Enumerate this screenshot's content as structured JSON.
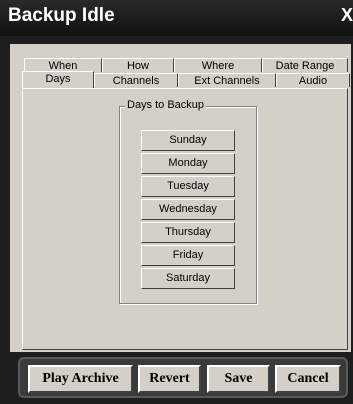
{
  "window": {
    "title": "Backup Idle",
    "close_glyph": "X"
  },
  "tabs_back": [
    "When",
    "How",
    "Where",
    "Date Range"
  ],
  "tabs_front": [
    "Days",
    "Channels",
    "Ext Channels",
    "Audio"
  ],
  "active_tab": "Days",
  "group": {
    "label": "Days to Backup",
    "days": [
      "Sunday",
      "Monday",
      "Tuesday",
      "Wednesday",
      "Thursday",
      "Friday",
      "Saturday"
    ]
  },
  "buttons": {
    "play_archive": "Play Archive",
    "revert": "Revert",
    "save": "Save",
    "cancel": "Cancel"
  }
}
